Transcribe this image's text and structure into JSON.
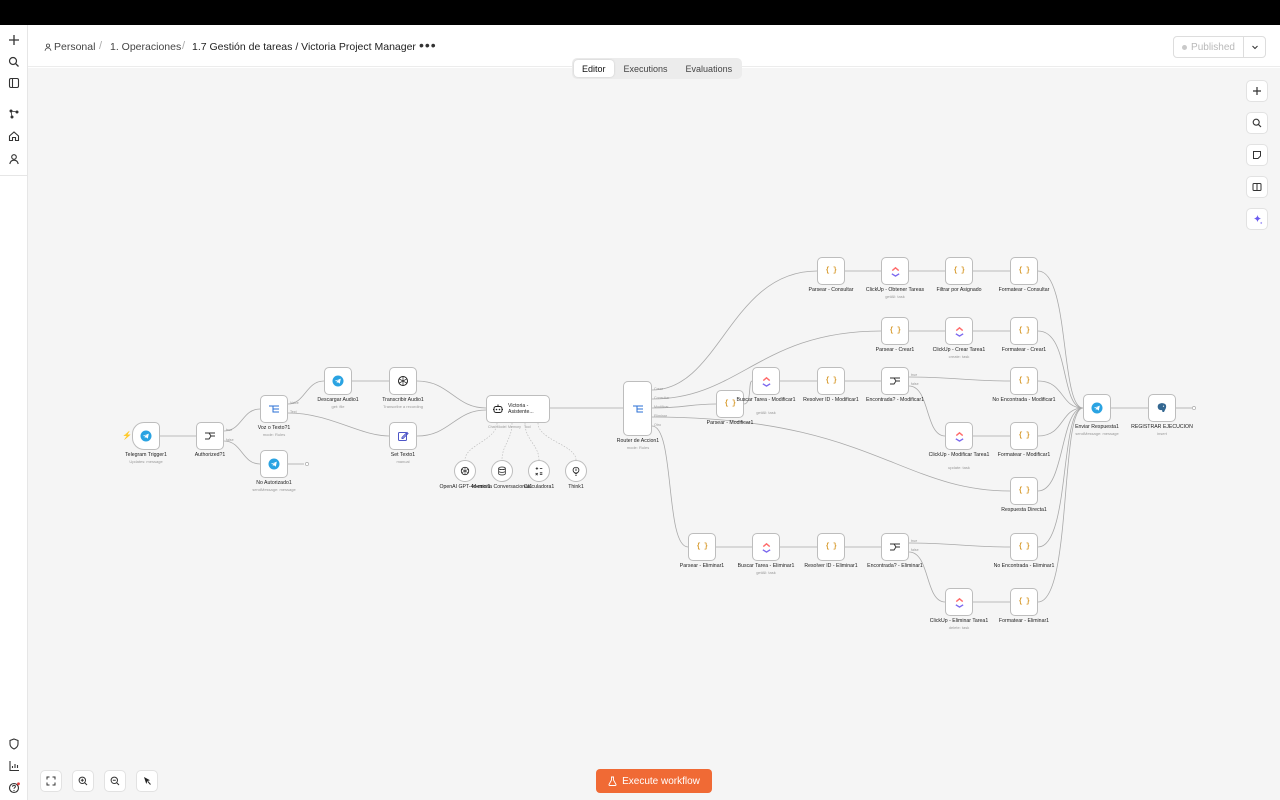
{
  "breadcrumb": {
    "project": "Personal",
    "folder": "1. Operaciones",
    "workflow": "1.7 Gestión de tareas / Victoria Project Manager"
  },
  "header": {
    "publish_label": "Published"
  },
  "tabs": [
    {
      "label": "Editor"
    },
    {
      "label": "Executions"
    },
    {
      "label": "Evaluations"
    }
  ],
  "execute_label": "Execute workflow",
  "colors": {
    "accent": "#f06a35",
    "telegram": "#2aa3e2",
    "clickup_a": "#7b68ee",
    "clickup_b": "#ff6b6b",
    "code": "#d79a2c"
  },
  "nodes": {
    "telegram_trigger": {
      "label": "Telegram Trigger1",
      "sub": "Updates: message",
      "icon": "telegram-icon"
    },
    "authorized": {
      "label": "Authorized?1",
      "icon": "if-icon",
      "ports": [
        "true",
        "false"
      ]
    },
    "voz_texto": {
      "label": "Voz o Texto?1",
      "sub": "mode: Rules",
      "icon": "switch-icon",
      "ports": [
        "Voice",
        "Text"
      ]
    },
    "no_autorizado": {
      "label": "No Autorizado1",
      "sub": "sendMessage: message",
      "icon": "telegram-icon"
    },
    "descargar_audio": {
      "label": "Descargar Audio1",
      "sub": "get: file",
      "icon": "telegram-icon"
    },
    "transcribir_audio": {
      "label": "Transcribir Audio1",
      "sub": "Transcribe a recording",
      "icon": "openai-icon"
    },
    "set_texto": {
      "label": "Set Texto1",
      "sub": "manual",
      "icon": "pencil-icon"
    },
    "victoria": {
      "label": "Victoria - Asistente...",
      "icon": "agent-icon",
      "ports": [
        "Chat Model",
        "Memory",
        "Tool"
      ]
    },
    "openai_model": {
      "label": "OpenAI GPT-4o-mini1",
      "icon": "openai-icon"
    },
    "memoria": {
      "label": "Memoria Conversacional1",
      "icon": "database-icon"
    },
    "calculadora": {
      "label": "Calculadora1",
      "icon": "calculator-icon"
    },
    "think": {
      "label": "Think1",
      "icon": "lightbulb-icon"
    },
    "router": {
      "label": "Router de Accion1",
      "sub": "mode: Rules",
      "icon": "switch-icon",
      "ports": [
        "Crear",
        "Consultar",
        "Modificar",
        "Eliminar",
        "Otro"
      ]
    },
    "parsear_consultar": {
      "label": "Parsear - Consultar",
      "icon": "code-icon"
    },
    "clickup_obtener": {
      "label": "ClickUp - Obtener Tareas",
      "sub": "getAll: task",
      "icon": "clickup-icon"
    },
    "filtrar": {
      "label": "Filtrar por Asignado",
      "icon": "code-icon"
    },
    "formatear_consultar": {
      "label": "Formatear - Consultar",
      "icon": "code-icon"
    },
    "parsear_crear": {
      "label": "Parsear - Crear1",
      "icon": "code-icon"
    },
    "clickup_crear": {
      "label": "ClickUp - Crear Tarea1",
      "sub": "create: task",
      "icon": "clickup-icon"
    },
    "formatear_crear": {
      "label": "Formatear - Crear1",
      "icon": "code-icon"
    },
    "parsear_modificar": {
      "label": "Parsear - Modificar1",
      "icon": "code-icon"
    },
    "buscar_modificar": {
      "label": "Buscar Tarea - Modificar1",
      "sub": "getAll: task",
      "icon": "clickup-icon"
    },
    "resolver_modificar": {
      "label": "Resolver ID - Modificar1",
      "icon": "code-icon"
    },
    "encontrada_modificar": {
      "label": "Encontrada? - Modificar1",
      "icon": "if-icon",
      "ports": [
        "true",
        "false"
      ]
    },
    "no_encontrada_modificar": {
      "label": "No Encontrada - Modificar1",
      "icon": "code-icon"
    },
    "clickup_modificar": {
      "label": "ClickUp - Modificar Tarea1",
      "sub": "update: task",
      "icon": "clickup-icon"
    },
    "formatear_modificar": {
      "label": "Formatear - Modificar1",
      "icon": "code-icon"
    },
    "respuesta_directa": {
      "label": "Respuesta Directa1",
      "icon": "code-icon"
    },
    "parsear_eliminar": {
      "label": "Parsear - Eliminar1",
      "icon": "code-icon"
    },
    "buscar_eliminar": {
      "label": "Buscar Tarea - Eliminar1",
      "sub": "getAll: task",
      "icon": "clickup-icon"
    },
    "resolver_eliminar": {
      "label": "Resolver ID - Eliminar1",
      "icon": "code-icon"
    },
    "encontrada_eliminar": {
      "label": "Encontrada? - Eliminar1",
      "icon": "if-icon",
      "ports": [
        "true",
        "false"
      ]
    },
    "no_encontrada_eliminar": {
      "label": "No Encontrada - Eliminar1",
      "icon": "code-icon"
    },
    "clickup_eliminar": {
      "label": "ClickUp - Eliminar Tarea1",
      "sub": "delete: task",
      "icon": "clickup-icon"
    },
    "formatear_eliminar": {
      "label": "Formatear - Eliminar1",
      "icon": "code-icon"
    },
    "enviar_respuesta": {
      "label": "Enviar Respuesta1",
      "sub": "sendMessage: message",
      "icon": "telegram-icon"
    },
    "registrar": {
      "label": "REGISTRAR EJECUCION",
      "sub": "insert",
      "icon": "postgres-icon"
    }
  }
}
